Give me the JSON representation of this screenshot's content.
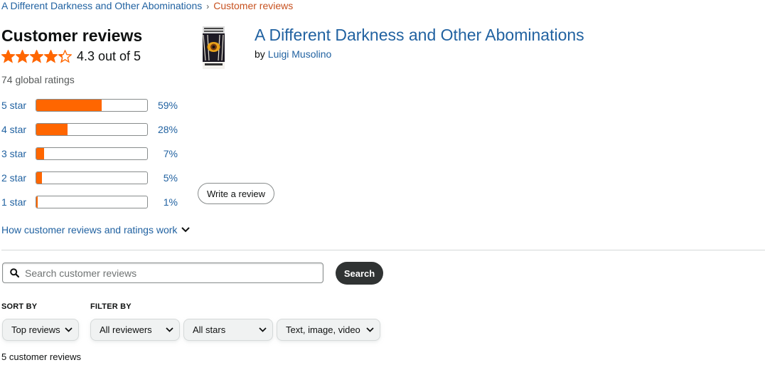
{
  "breadcrumb": {
    "parent": "A Different Darkness and Other Abominations",
    "separator": "›",
    "current": "Customer reviews"
  },
  "reviews": {
    "heading": "Customer reviews",
    "stars": 4.3,
    "rating_text": "4.3 out of 5",
    "global_ratings": "74 global ratings"
  },
  "histogram": [
    {
      "label": "5 star",
      "percent": 59,
      "percent_text": "59%"
    },
    {
      "label": "4 star",
      "percent": 28,
      "percent_text": "28%"
    },
    {
      "label": "3 star",
      "percent": 7,
      "percent_text": "7%"
    },
    {
      "label": "2 star",
      "percent": 5,
      "percent_text": "5%"
    },
    {
      "label": "1 star",
      "percent": 1,
      "percent_text": "1%"
    }
  ],
  "how_reviews_work": "How customer reviews and ratings work",
  "product": {
    "title": "A Different Darkness and Other Abominations",
    "by": "by",
    "author": "Luigi Musolino"
  },
  "write_review": "Write a review",
  "search": {
    "placeholder": "Search customer reviews",
    "button": "Search"
  },
  "sort": {
    "label": "SORT BY",
    "selected": "Top reviews"
  },
  "filter": {
    "label": "FILTER BY",
    "reviewers": "All reviewers",
    "stars": "All stars",
    "format": "Text, image, video"
  },
  "review_count": "5 customer reviews",
  "colors": {
    "link": "#2162A1",
    "star": "#FF6600",
    "bar_fill": "#FF6600",
    "breadcrumb_current": "#C7511F",
    "search_button": "#303333"
  }
}
